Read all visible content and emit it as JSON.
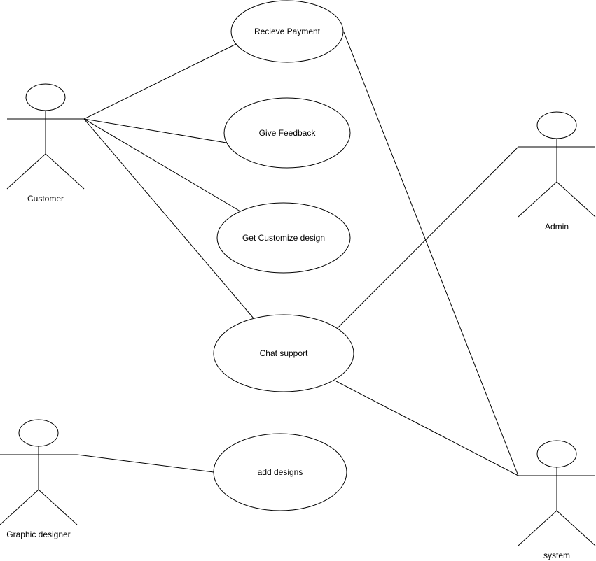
{
  "diagram": {
    "type": "use-case",
    "actors": [
      {
        "id": "customer",
        "label": "Customer"
      },
      {
        "id": "admin",
        "label": "Admin"
      },
      {
        "id": "system",
        "label": "system"
      },
      {
        "id": "graphic_designer",
        "label": "Graphic designer"
      }
    ],
    "use_cases": [
      {
        "id": "recieve_payment",
        "label": "Recieve Payment"
      },
      {
        "id": "give_feedback",
        "label": "Give Feedback"
      },
      {
        "id": "get_customize_design",
        "label": "Get Customize design"
      },
      {
        "id": "chat_support",
        "label": "Chat support"
      },
      {
        "id": "add_designs",
        "label": "add designs"
      }
    ],
    "associations": [
      {
        "from": "customer",
        "to": "recieve_payment"
      },
      {
        "from": "customer",
        "to": "give_feedback"
      },
      {
        "from": "customer",
        "to": "get_customize_design"
      },
      {
        "from": "customer",
        "to": "chat_support"
      },
      {
        "from": "admin",
        "to": "chat_support"
      },
      {
        "from": "system",
        "to": "recieve_payment"
      },
      {
        "from": "system",
        "to": "chat_support"
      },
      {
        "from": "graphic_designer",
        "to": "add_designs"
      }
    ],
    "colors": {
      "stroke": "#000000",
      "background": "#ffffff"
    }
  }
}
